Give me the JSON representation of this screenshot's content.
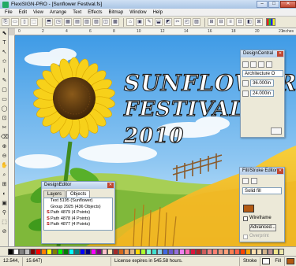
{
  "window": {
    "title": "FlexiSIGN-PRO - [Sunflower Festival.fs]",
    "minimize": "–",
    "maximize": "□",
    "close": "✕"
  },
  "menu": [
    "File",
    "Edit",
    "View",
    "Arrange",
    "Text",
    "Effects",
    "Bitmap",
    "Window",
    "Help"
  ],
  "toolbar": {
    "buttons": [
      "⎘",
      "▭",
      "▯",
      "⬚",
      "⬒",
      "◳",
      "▦",
      "▤",
      "▥",
      "▧",
      "◫",
      "▩",
      "⌂",
      "▣",
      "✎",
      "⬓",
      "◩",
      "✂",
      "◰",
      "▨",
      "⊞",
      "⊟",
      "≡",
      "⊡",
      "◧",
      "⊠"
    ]
  },
  "ruler": {
    "ticks": [
      "0",
      "2",
      "4",
      "6",
      "8",
      "10",
      "12",
      "14",
      "16",
      "18",
      "20",
      "21"
    ],
    "unit": "inches"
  },
  "tools": [
    "⬉",
    "T",
    "↖",
    "✩",
    "⌇",
    "✎",
    "▢",
    "▭",
    "◯",
    "⊡",
    "✂",
    "⌫",
    "⊕",
    "⊖",
    "✋",
    "⌕",
    "⊞",
    "◐",
    "▣",
    "⚲",
    "⬚",
    "⊘"
  ],
  "artwork": {
    "line1": "SUNFLOWER",
    "line2": "FESTIVAL",
    "line3": "2010"
  },
  "design_central": {
    "title": "DesignCentral",
    "font": "Architecture O",
    "width": "36.000in",
    "height": "24.000in"
  },
  "design_editor": {
    "title": "DesignEditor",
    "tabs": [
      "Layers",
      "Objects"
    ],
    "active_tab": "Objects",
    "rows": [
      {
        "icon": "",
        "text": "Text 5195 (Sunflower)"
      },
      {
        "icon": "",
        "text": "Group 2925 (436 Objects)"
      },
      {
        "icon": "S",
        "text": "Path 4879 (4 Points)"
      },
      {
        "icon": "S",
        "text": "Path 4878 (4 Points)"
      },
      {
        "icon": "S",
        "text": "Path 4877 (4 Points)"
      }
    ]
  },
  "fill_stroke": {
    "title": "Fill/Stroke Editor",
    "fill_type": "Solid fill",
    "fill_color": "#b35a12",
    "wireframe_label": "Wireframe",
    "advanced_label": "Advanced...",
    "overprint_label": "Overprint"
  },
  "palette": [
    "#000000",
    "#ffffff",
    "#808080",
    "#c0c0c0",
    "#800000",
    "#ff0000",
    "#ff8000",
    "#ffff00",
    "#808000",
    "#00ff00",
    "#008000",
    "#00ffff",
    "#008080",
    "#0000ff",
    "#000080",
    "#ff00ff",
    "#800080",
    "#ffc0cb",
    "#ffe4b5",
    "#a52a2a",
    "#d2691e",
    "#f4a460",
    "#deb887",
    "#ffd700",
    "#adff2f",
    "#7fffd4",
    "#40e0d0",
    "#87ceeb",
    "#4169e1",
    "#6a5acd",
    "#9370db",
    "#ee82ee",
    "#ff69b4",
    "#dc143c",
    "#b22222",
    "#cd5c5c",
    "#f08080",
    "#fa8072",
    "#e9967a",
    "#ffa07a",
    "#ff7f50",
    "#ff6347",
    "#ff4500",
    "#ffa500",
    "#ffdead",
    "#f5deb3",
    "#d2b48c",
    "#bc8f8f",
    "#f0e68c",
    "#eee8aa"
  ],
  "status": {
    "coords": "12.544,",
    "coords2": "15.647)",
    "license": "License expires in 545.58 hours.",
    "stroke_label": "Stroke",
    "fill_label": "Fill"
  },
  "colors": {
    "sky_top": "#3f9be6",
    "sky_bottom": "#cfe9fb",
    "field": "#f2c232",
    "text_fill": "#ffffff",
    "text_stroke": "#1a1a1a"
  }
}
